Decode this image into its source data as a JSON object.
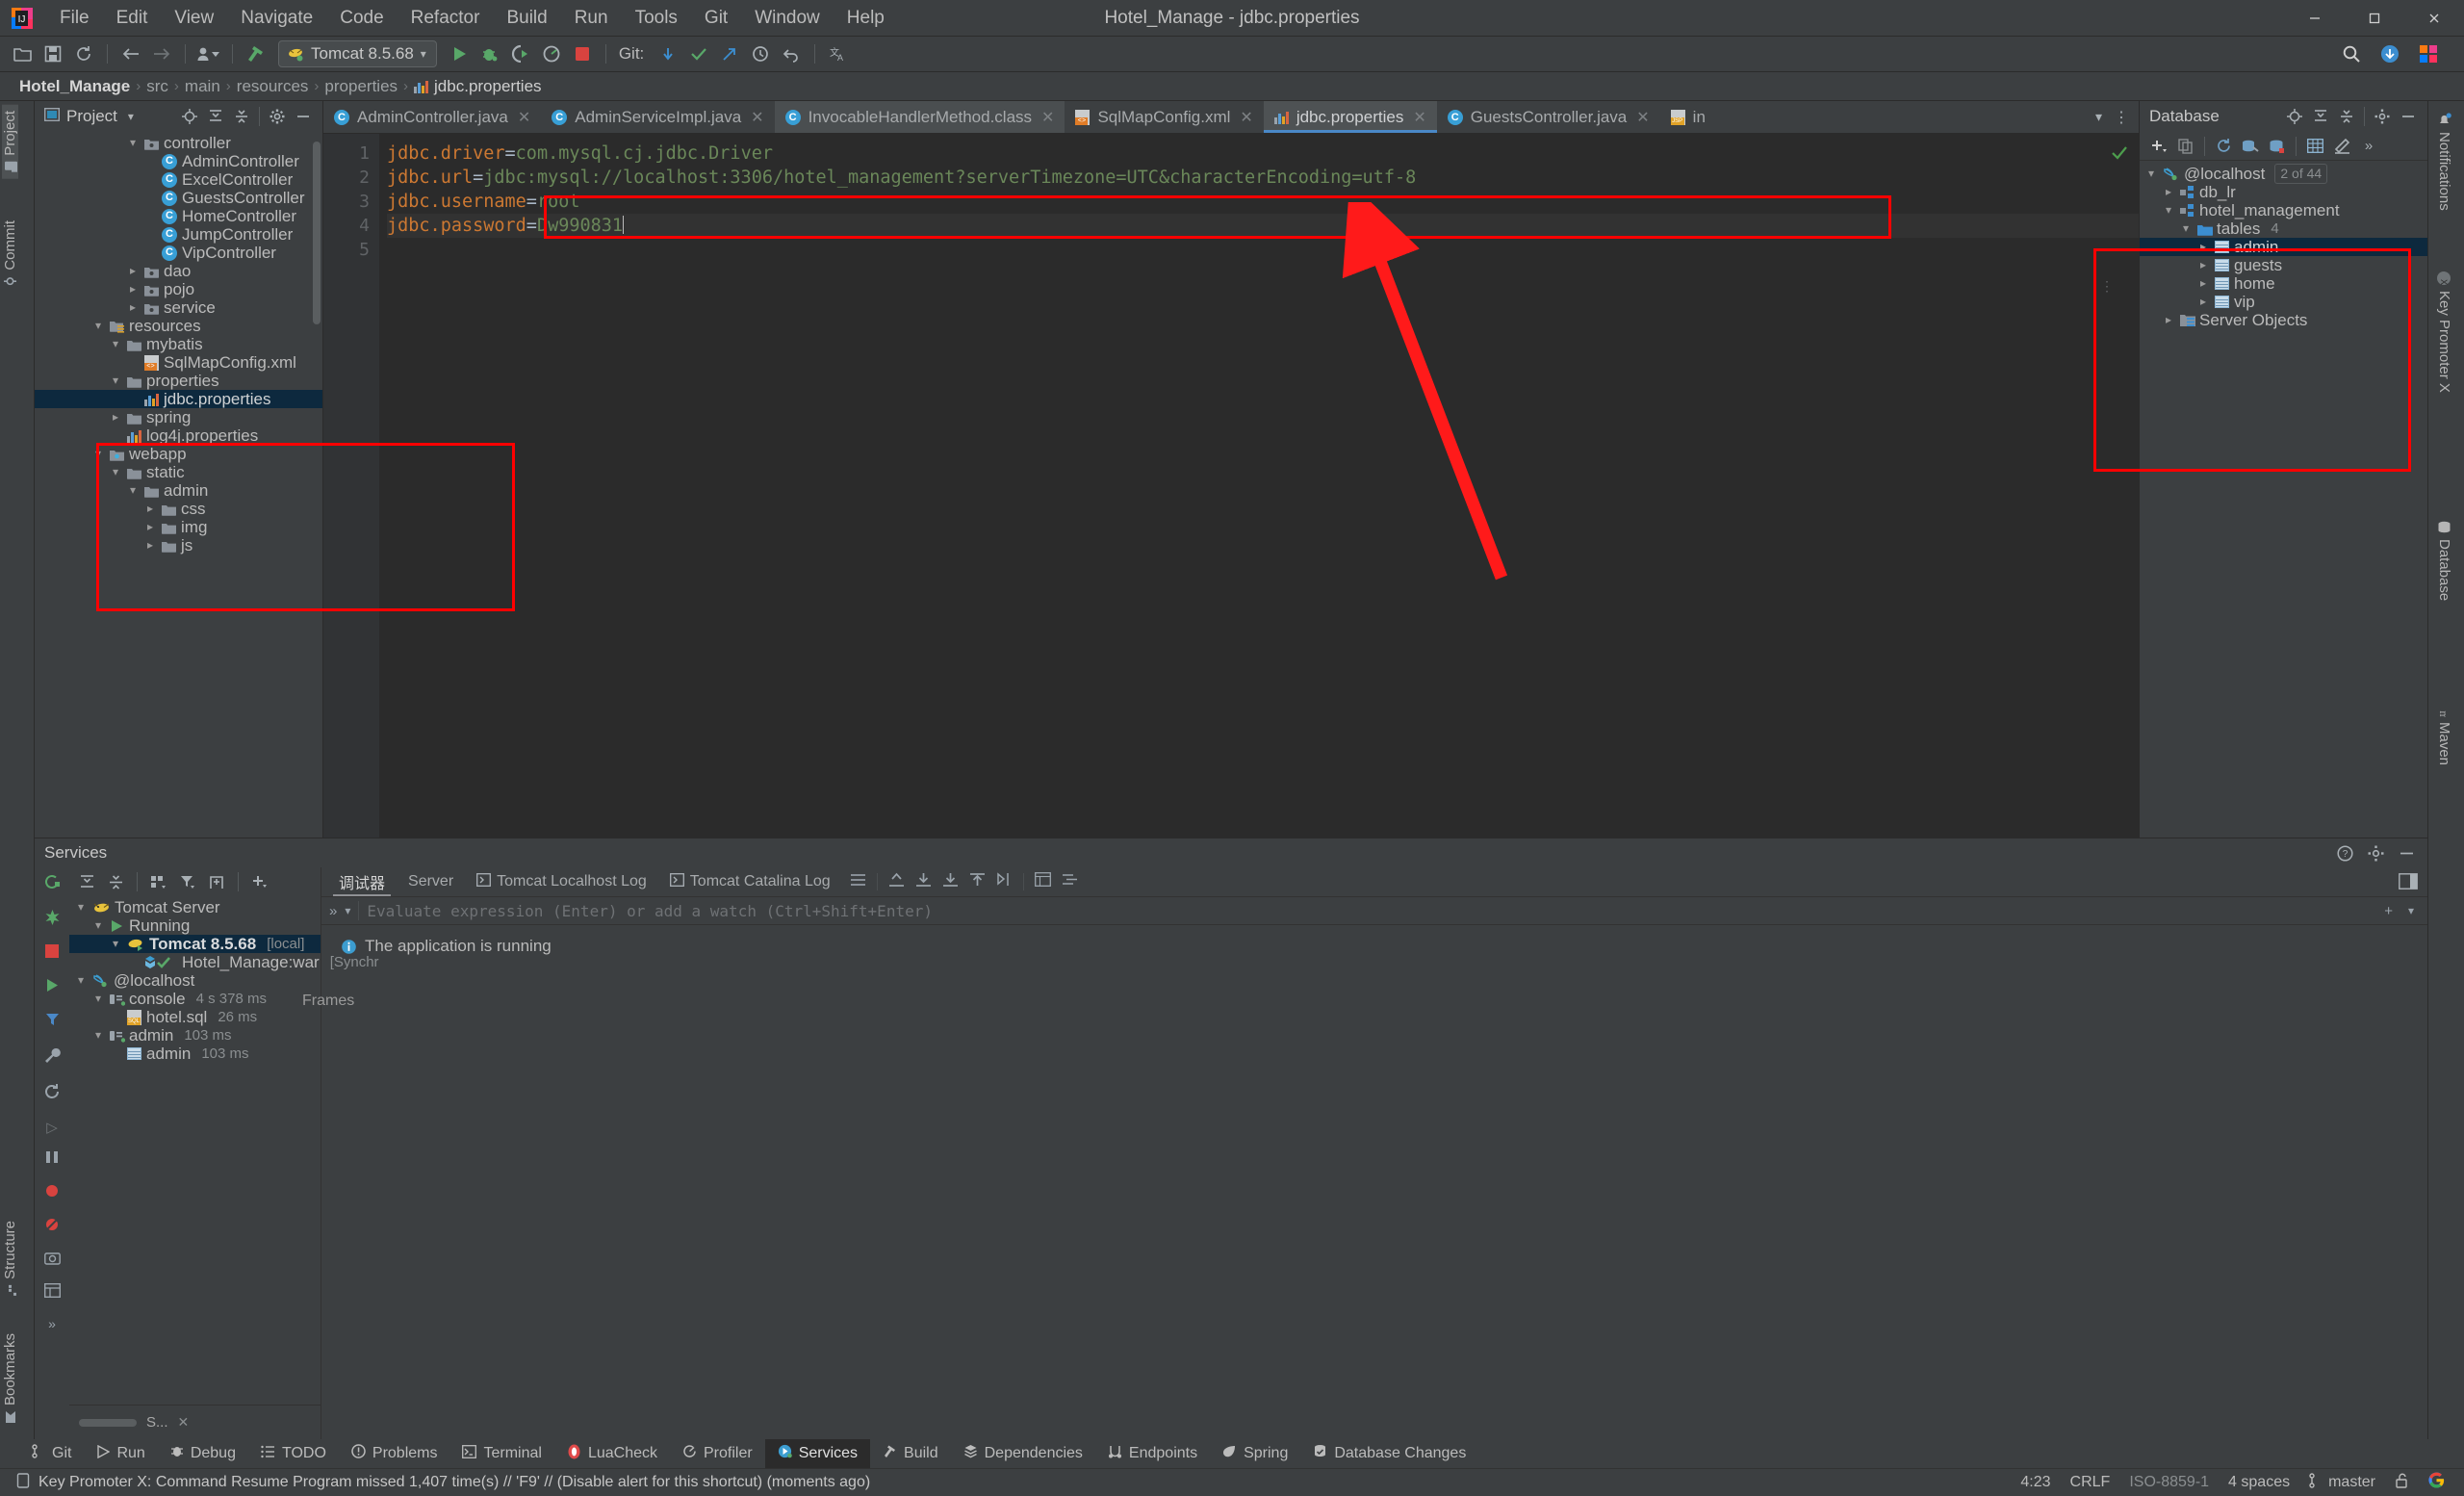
{
  "window": {
    "title": "Hotel_Manage - jdbc.properties",
    "minimize": "─",
    "maximize": "☐",
    "close": "✕"
  },
  "menu": [
    "File",
    "Edit",
    "View",
    "Navigate",
    "Code",
    "Refactor",
    "Build",
    "Run",
    "Tools",
    "Git",
    "Window",
    "Help"
  ],
  "toolbar": {
    "open_icon": "open-folder-icon",
    "save_icon": "save-icon",
    "sync_icon": "sync-icon",
    "back_icon": "back-arrow-icon",
    "forward_icon": "forward-arrow-icon",
    "profile_icon": "user-profile-icon",
    "build_icon": "build-hammer-icon",
    "run_config": "Tomcat 8.5.68",
    "run_icon": "run-icon",
    "debug_icon": "debug-icon",
    "run_coverage_icon": "run-with-coverage-icon",
    "profile_run_icon": "profile-icon",
    "stop_icon": "stop-icon",
    "git_label": "Git:",
    "update_icon": "git-update-icon",
    "commit_icon": "git-commit-icon",
    "push_icon": "git-push-icon",
    "history_icon": "history-icon",
    "rollback_icon": "rollback-icon",
    "translate_icon": "translate-icon",
    "search_icon": "search-everywhere-icon",
    "plugin_icon": "plugin-update-icon",
    "ide_icon": "ide-icon"
  },
  "breadcrumb": {
    "items": [
      "Hotel_Manage",
      "src",
      "main",
      "resources",
      "properties"
    ],
    "file": "jdbc.properties",
    "separator": "›"
  },
  "left_stripe": [
    {
      "label": "Project",
      "icon": "project-icon",
      "selected": true
    },
    {
      "label": "Commit",
      "icon": "commit-icon",
      "selected": false
    },
    {
      "label": "Structure",
      "icon": "structure-icon",
      "selected": false
    },
    {
      "label": "Bookmarks",
      "icon": "bookmarks-icon",
      "selected": false
    }
  ],
  "right_stripe": [
    {
      "label": "Notifications",
      "icon": "bell-icon"
    },
    {
      "label": "Key Promoter X",
      "icon": "key-promoter-icon"
    },
    {
      "label": "Database",
      "icon": "database-icon"
    },
    {
      "label": "Maven",
      "icon": "maven-icon"
    }
  ],
  "project_panel": {
    "title": "Project",
    "dropdown_icon": "chevron-down-icon",
    "locate_icon": "locate-file-icon",
    "expand_icon": "expand-all-icon",
    "collapse_icon": "collapse-all-icon",
    "settings_icon": "gear-icon",
    "hide_icon": "hide-panel-icon",
    "tree": [
      {
        "label": "controller",
        "icon": "package-icon",
        "indent": 5,
        "arrow": "down",
        "type": "pkg"
      },
      {
        "label": "AdminController",
        "icon": "java-class-icon",
        "indent": 6,
        "arrow": "",
        "type": "class"
      },
      {
        "label": "ExcelController",
        "icon": "java-class-icon",
        "indent": 6,
        "arrow": "",
        "type": "class"
      },
      {
        "label": "GuestsController",
        "icon": "java-class-icon",
        "indent": 6,
        "arrow": "",
        "type": "class"
      },
      {
        "label": "HomeController",
        "icon": "java-class-icon",
        "indent": 6,
        "arrow": "",
        "type": "class"
      },
      {
        "label": "JumpController",
        "icon": "java-class-icon",
        "indent": 6,
        "arrow": "",
        "type": "class"
      },
      {
        "label": "VipController",
        "icon": "java-class-icon",
        "indent": 6,
        "arrow": "",
        "type": "class"
      },
      {
        "label": "dao",
        "icon": "package-icon",
        "indent": 5,
        "arrow": "right",
        "type": "pkg"
      },
      {
        "label": "pojo",
        "icon": "package-icon",
        "indent": 5,
        "arrow": "right",
        "type": "pkg"
      },
      {
        "label": "service",
        "icon": "package-icon",
        "indent": 5,
        "arrow": "right",
        "type": "pkg"
      },
      {
        "label": "resources",
        "icon": "resources-root-icon",
        "indent": 3,
        "arrow": "down",
        "type": "src"
      },
      {
        "label": "mybatis",
        "icon": "folder-icon",
        "indent": 4,
        "arrow": "down",
        "type": "folder"
      },
      {
        "label": "SqlMapConfig.xml",
        "icon": "xml-file-icon",
        "indent": 5,
        "arrow": "",
        "type": "xml"
      },
      {
        "label": "properties",
        "icon": "folder-icon",
        "indent": 4,
        "arrow": "down",
        "type": "folder"
      },
      {
        "label": "jdbc.properties",
        "icon": "properties-file-icon",
        "indent": 5,
        "arrow": "",
        "type": "prop",
        "selected": true
      },
      {
        "label": "spring",
        "icon": "folder-icon",
        "indent": 4,
        "arrow": "right",
        "type": "folder"
      },
      {
        "label": "log4j.properties",
        "icon": "properties-file-icon",
        "indent": 4,
        "arrow": "",
        "type": "prop"
      },
      {
        "label": "webapp",
        "icon": "webapp-root-icon",
        "indent": 3,
        "arrow": "down",
        "type": "webapp"
      },
      {
        "label": "static",
        "icon": "folder-icon",
        "indent": 4,
        "arrow": "down",
        "type": "folder"
      },
      {
        "label": "admin",
        "icon": "folder-icon",
        "indent": 5,
        "arrow": "down",
        "type": "folder"
      },
      {
        "label": "css",
        "icon": "folder-icon",
        "indent": 6,
        "arrow": "right",
        "type": "folder"
      },
      {
        "label": "img",
        "icon": "folder-icon",
        "indent": 6,
        "arrow": "right",
        "type": "folder"
      },
      {
        "label": "js",
        "icon": "folder-icon",
        "indent": 6,
        "arrow": "right",
        "type": "folder"
      }
    ]
  },
  "editor": {
    "tabs": [
      {
        "label": "AdminController.java",
        "type": "class",
        "active": false,
        "close": "✕"
      },
      {
        "label": "AdminServiceImpl.java",
        "type": "class",
        "active": false,
        "close": "✕"
      },
      {
        "label": "InvocableHandlerMethod.class",
        "type": "class",
        "active": false,
        "highlight": true,
        "close": "✕"
      },
      {
        "label": "SqlMapConfig.xml",
        "type": "xml",
        "active": false,
        "close": "✕"
      },
      {
        "label": "jdbc.properties",
        "type": "prop",
        "active": true,
        "close": "✕"
      },
      {
        "label": "GuestsController.java",
        "type": "class",
        "active": false,
        "close": "✕"
      },
      {
        "label": "in",
        "type": "jsp",
        "active": false,
        "close": ""
      }
    ],
    "tab_overflow_icon": "chevron-down-icon",
    "tab_menu_icon": "more-options-icon",
    "inspection_ok_icon": "inspections-ok-icon",
    "lines": [
      {
        "n": "1",
        "key": "jdbc.driver",
        "eq": "=",
        "value": "com.mysql.cj.jdbc.Driver"
      },
      {
        "n": "2",
        "key": "jdbc.url",
        "eq": "=",
        "value": "jdbc:mysql://localhost:3306/hotel_management?serverTimezone=UTC&characterEncoding=utf-8"
      },
      {
        "n": "3",
        "key": "jdbc.username",
        "eq": "=",
        "value": "root"
      },
      {
        "n": "4",
        "key": "jdbc.password",
        "eq": "=",
        "value": "Dw990831",
        "current": true
      },
      {
        "n": "5",
        "key": "",
        "eq": "",
        "value": ""
      }
    ]
  },
  "database_panel": {
    "title": "Database",
    "locate_icon": "locate-icon",
    "expand_icon": "expand-all-icon",
    "collapse_icon": "collapse-all-icon",
    "settings_icon": "gear-icon",
    "hide_icon": "hide-panel-icon",
    "toolbar": {
      "add_icon": "add-plus-icon",
      "copy_icon": "duplicate-icon",
      "refresh_icon": "refresh-icon",
      "sync_icon": "db-sync-icon",
      "disconnect_icon": "db-disconnect-icon",
      "table_icon": "table-editor-icon",
      "console_icon": "query-console-icon",
      "more_icon": "chevron-more-icon"
    },
    "tree": [
      {
        "label": "@localhost",
        "badge": "2 of 44",
        "icon": "mysql-dolphin-icon",
        "indent": 0,
        "arrow": "down"
      },
      {
        "label": "db_lr",
        "icon": "schema-icon",
        "indent": 1,
        "arrow": "right"
      },
      {
        "label": "hotel_management",
        "icon": "schema-icon",
        "indent": 1,
        "arrow": "down"
      },
      {
        "label": "tables",
        "count": "4",
        "icon": "db-folder-icon",
        "indent": 2,
        "arrow": "down"
      },
      {
        "label": "admin",
        "icon": "table-icon",
        "indent": 3,
        "arrow": "right",
        "selected": true
      },
      {
        "label": "guests",
        "icon": "table-icon",
        "indent": 3,
        "arrow": "right"
      },
      {
        "label": "home",
        "icon": "table-icon",
        "indent": 3,
        "arrow": "right"
      },
      {
        "label": "vip",
        "icon": "table-icon",
        "indent": 3,
        "arrow": "right"
      },
      {
        "label": "Server Objects",
        "icon": "server-objects-icon",
        "indent": 1,
        "arrow": "right"
      }
    ]
  },
  "services": {
    "title": "Services",
    "settings_icon": "gear-icon",
    "help_icon": "help-icon",
    "hide_icon": "hide-panel-icon",
    "vtools": [
      "rerun-icon",
      "stop-icon",
      "stop-red-icon",
      "resume-icon",
      "filter-icon",
      "wrench-icon",
      "restart-icon",
      "step-over-icon",
      "pause-icon",
      "mute-breakpoints-icon",
      "no-breakpoints-icon",
      "camera-icon",
      "layout-icon",
      "more-icon"
    ],
    "toolbar": [
      "rerun-icon",
      "expand-all-icon",
      "collapse-all-icon",
      "group-icon",
      "filter-icon",
      "add-tab-icon",
      "add-icon"
    ],
    "tree": [
      {
        "label": "Tomcat Server",
        "icon": "tomcat-icon",
        "indent": 0,
        "arrow": "down"
      },
      {
        "label": "Running",
        "icon": "run-green-icon",
        "indent": 1,
        "arrow": "down"
      },
      {
        "label": "Tomcat 8.5.68",
        "suffix": "[local]",
        "icon": "tomcat-run-icon",
        "indent": 2,
        "arrow": "down",
        "selected": true,
        "bold": true
      },
      {
        "label": "Hotel_Manage:war",
        "suffix": "[Synchr",
        "icon": "artifact-icon",
        "indent": 3,
        "arrow": ""
      },
      {
        "label": "@localhost",
        "icon": "mysql-dolphin-icon",
        "indent": 0,
        "arrow": "down"
      },
      {
        "label": "console",
        "suffix": "4 s 378 ms",
        "icon": "console-icon",
        "indent": 1,
        "arrow": "down"
      },
      {
        "label": "hotel.sql",
        "suffix": "26 ms",
        "icon": "sql-file-icon",
        "indent": 2,
        "arrow": ""
      },
      {
        "label": "admin",
        "suffix": "103 ms",
        "icon": "console-icon",
        "indent": 1,
        "arrow": "down"
      },
      {
        "label": "admin",
        "suffix": "103 ms",
        "icon": "table-icon",
        "indent": 2,
        "arrow": ""
      }
    ],
    "tabs": [
      {
        "label": "调试器",
        "active": true
      },
      {
        "label": "Server",
        "active": false
      },
      {
        "label": "Tomcat Localhost Log",
        "icon": "console-log-icon",
        "active": false
      },
      {
        "label": "Tomcat Catalina Log",
        "icon": "console-log-icon",
        "active": false
      }
    ],
    "tab_icons": [
      "menu-lines-icon",
      "step-out-icon",
      "step-into-icon",
      "force-step-into-icon",
      "step-up-icon",
      "run-to-cursor-icon",
      "evaluate-icon",
      "settings-icon"
    ],
    "eval_placeholder": "Evaluate expression (Enter) or add a watch (Ctrl+Shift+Enter)",
    "eval_more_icon": "chevron-double-right-icon",
    "eval_dropdown_icon": "chevron-down-icon",
    "frames_label": "Frames",
    "status_message": "The application is running",
    "status_icon": "info-icon",
    "close_icon": "✕",
    "tree_label_short": "S..."
  },
  "statusbar": {
    "tools": [
      {
        "label": "Git",
        "icon": "git-branch-icon",
        "active": false
      },
      {
        "label": "Run",
        "icon": "run-icon",
        "active": false
      },
      {
        "label": "Debug",
        "icon": "debug-bug-icon",
        "active": false
      },
      {
        "label": "TODO",
        "icon": "todo-list-icon",
        "active": false
      },
      {
        "label": "Problems",
        "icon": "problems-icon",
        "active": false
      },
      {
        "label": "Terminal",
        "icon": "terminal-icon",
        "active": false
      },
      {
        "label": "LuaCheck",
        "icon": "luacheck-icon",
        "active": false
      },
      {
        "label": "Profiler",
        "icon": "profiler-icon",
        "active": false
      },
      {
        "label": "Services",
        "icon": "services-icon",
        "active": true
      },
      {
        "label": "Build",
        "icon": "build-hammer-icon",
        "active": false
      },
      {
        "label": "Dependencies",
        "icon": "dependencies-icon",
        "active": false
      },
      {
        "label": "Endpoints",
        "icon": "endpoints-icon",
        "active": false
      },
      {
        "label": "Spring",
        "icon": "spring-leaf-icon",
        "active": false
      },
      {
        "label": "Database Changes",
        "icon": "database-changes-icon",
        "active": false
      }
    ],
    "message_icon": "key-promoter-notification-icon",
    "message": "Key Promoter X: Command Resume Program missed 1,407 time(s) // 'F9' // (Disable alert for this shortcut) (moments ago)",
    "caret_position": "4:23",
    "line_separator": "CRLF",
    "encoding": "ISO-8859-1",
    "indent": "4 spaces",
    "branch": "master",
    "branch_icon": "git-branch-icon",
    "lock_icon": "unlocked-icon",
    "google_icon": "google-icon"
  },
  "colors": {
    "accent_blue": "#4a88c7",
    "selection_blue": "#0d293e",
    "annotation_red": "#ff0000",
    "key_orange": "#cc7832",
    "value_green": "#6a8759",
    "editor_bg": "#2b2b2b",
    "panel_bg": "#3c3f41"
  }
}
